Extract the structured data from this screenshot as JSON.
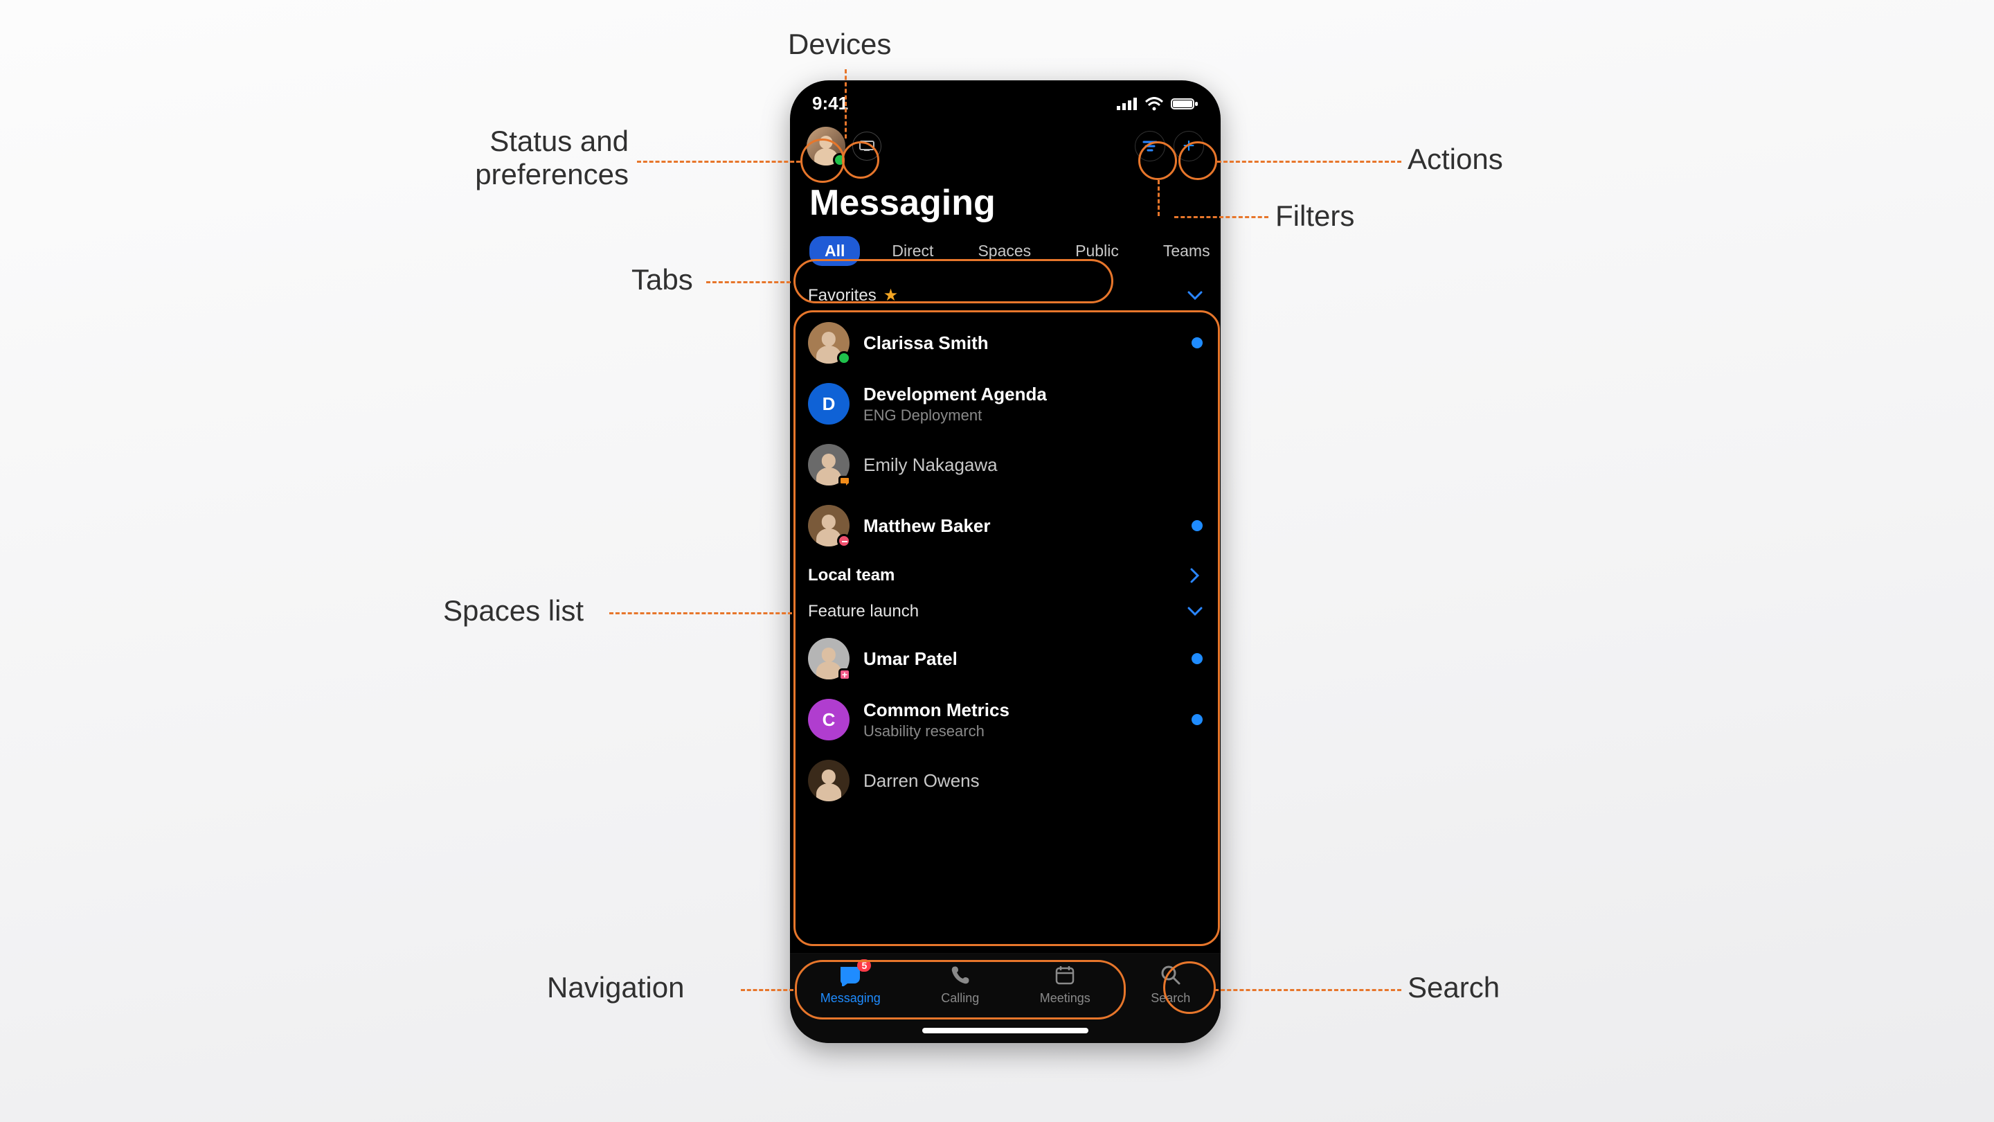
{
  "annotations": {
    "devices": "Devices",
    "status_prefs_l1": "Status and",
    "status_prefs_l2": "preferences",
    "actions": "Actions",
    "filters": "Filters",
    "tabs": "Tabs",
    "spaces": "Spaces list",
    "navigation": "Navigation",
    "search": "Search"
  },
  "status": {
    "time": "9:41"
  },
  "header": {
    "title": "Messaging"
  },
  "tabs": {
    "items": [
      "All",
      "Direct",
      "Spaces",
      "Public",
      "Teams"
    ],
    "active": "All"
  },
  "sections": {
    "favorites": {
      "label": "Favorites"
    },
    "local_team": {
      "label": "Local team"
    },
    "feature_launch": {
      "label": "Feature launch"
    }
  },
  "rows": {
    "clarissa": {
      "name": "Clarissa Smith"
    },
    "devagenda": {
      "name": "Development Agenda",
      "sub": "ENG Deployment",
      "initial": "D"
    },
    "emily": {
      "name": "Emily Nakagawa"
    },
    "matthew": {
      "name": "Matthew Baker"
    },
    "umar": {
      "name": "Umar Patel"
    },
    "common": {
      "name": "Common Metrics",
      "sub": "Usability research",
      "initial": "C"
    },
    "darren": {
      "name": "Darren Owens"
    }
  },
  "nav": {
    "messaging": {
      "label": "Messaging",
      "badge": "5"
    },
    "calling": {
      "label": "Calling"
    },
    "meetings": {
      "label": "Meetings"
    },
    "search": {
      "label": "Search"
    }
  }
}
